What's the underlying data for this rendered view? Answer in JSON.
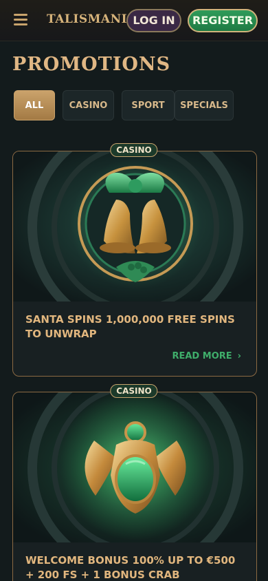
{
  "header": {
    "logo_text": "TALISMANIA",
    "login_label": "LOG IN",
    "register_label": "REGISTER"
  },
  "page": {
    "title": "PROMOTIONS"
  },
  "filters": [
    {
      "label": "ALL",
      "active": true
    },
    {
      "label": "CASINO",
      "active": false
    },
    {
      "label": "SPORT",
      "active": false
    },
    {
      "label": "SPECIALS",
      "active": false
    }
  ],
  "promotions": [
    {
      "badge": "CASINO",
      "title": "SANTA SPINS 1,000,000 FREE SPINS TO UNWRAP",
      "read_more": "READ MORE",
      "image_icon": "golden-bells-icon"
    },
    {
      "badge": "CASINO",
      "title": "WELCOME BONUS 100% UP TO €500 + 200 FS + 1 BONUS CRAB",
      "image_icon": "scarab-amulet-icon"
    }
  ],
  "colors": {
    "accent_gold": "#e0b784",
    "accent_green": "#3fae6b",
    "background": "#131b1c"
  }
}
